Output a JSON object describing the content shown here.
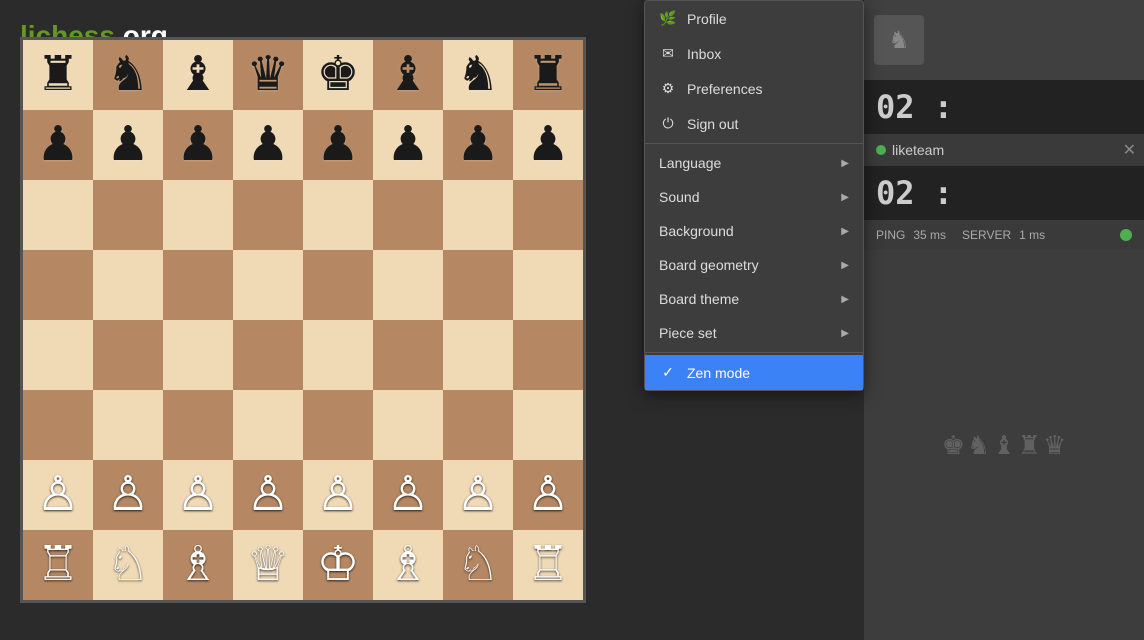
{
  "logo": {
    "part1": "lichess",
    "part2": ".org"
  },
  "menu": {
    "items_top": [
      {
        "id": "profile",
        "label": "Profile",
        "icon": "🌿"
      },
      {
        "id": "inbox",
        "label": "Inbox",
        "icon": "✉"
      },
      {
        "id": "preferences",
        "label": "Preferences",
        "icon": "⚙"
      },
      {
        "id": "signout",
        "label": "Sign out",
        "icon": "⏻"
      }
    ],
    "items_bottom": [
      {
        "id": "language",
        "label": "Language",
        "icon": "🌐",
        "arrow": true
      },
      {
        "id": "sound",
        "label": "Sound",
        "icon": "🔊",
        "arrow": true
      },
      {
        "id": "background",
        "label": "Background",
        "icon": "🖼",
        "arrow": true
      },
      {
        "id": "board-geometry",
        "label": "Board geometry",
        "icon": "⬛",
        "arrow": true
      },
      {
        "id": "board-theme",
        "label": "Board theme",
        "icon": "🎨",
        "arrow": true
      },
      {
        "id": "piece-set",
        "label": "Piece set",
        "icon": "♟",
        "arrow": true
      }
    ],
    "zen_mode": {
      "label": "Zen mode",
      "active": true
    }
  },
  "game": {
    "timer1": "02 :",
    "timer2": "02 :",
    "player_name": "liketeam",
    "ping_label": "PING",
    "ping_value": "35 ms",
    "server_label": "SERVER",
    "server_value": "1 ms"
  },
  "board": {
    "pieces": [
      [
        "♜",
        "♞",
        "♝",
        "♛",
        "♚",
        "♝",
        "♞",
        "♜"
      ],
      [
        "♟",
        "♟",
        "♟",
        "♟",
        "♟",
        "♟",
        "♟",
        "♟"
      ],
      [
        "",
        "",
        "",
        "",
        "",
        "",
        "",
        ""
      ],
      [
        "",
        "",
        "",
        "",
        "",
        "",
        "",
        ""
      ],
      [
        "",
        "",
        "",
        "",
        "",
        "",
        "",
        ""
      ],
      [
        "",
        "",
        "",
        "",
        "",
        "",
        "",
        ""
      ],
      [
        "♙",
        "♙",
        "♙",
        "♙",
        "♙",
        "♙",
        "♙",
        "♙"
      ],
      [
        "♖",
        "♘",
        "♗",
        "♕",
        "♔",
        "♗",
        "♘",
        "♖"
      ]
    ]
  }
}
